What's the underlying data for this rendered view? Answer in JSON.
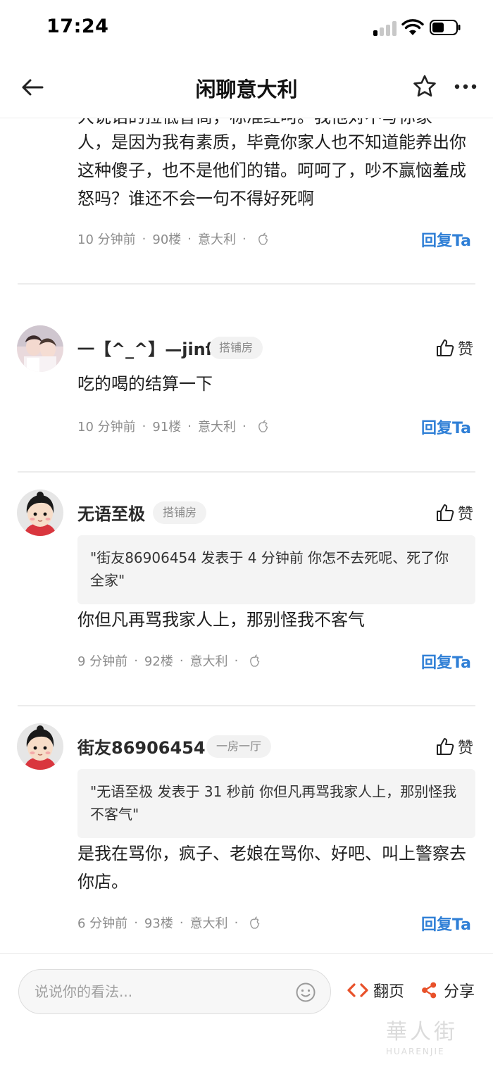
{
  "status_bar": {
    "time": "17:24"
  },
  "nav": {
    "title": "闲聊意大利"
  },
  "comments": [
    {
      "body_partial_top": "大说话的拉低智商，标准红呵。我他对不写你家",
      "body": "人，是因为我有素质，毕竟你家人也不知道能养出你这种傻子，也不是他们的错。呵呵了，吵不赢恼羞成怒吗？谁还不会一句不得好死啊",
      "time": "10 分钟前",
      "floor": "90楼",
      "location": "意大利",
      "reply_label": "回复Ta"
    },
    {
      "author": "一【^_^】—jinf",
      "badge": "搭铺房",
      "like_label": "赞",
      "body": "吃的喝的结算一下",
      "time": "10 分钟前",
      "floor": "91楼",
      "location": "意大利",
      "reply_label": "回复Ta"
    },
    {
      "author": "无语至极",
      "badge": "搭铺房",
      "like_label": "赞",
      "quote": "\"街友86906454 发表于 4 分钟前 你怎不去死呢、死了你全家\"",
      "body": "你但凡再骂我家人上，那别怪我不客气",
      "time": "9 分钟前",
      "floor": "92楼",
      "location": "意大利",
      "reply_label": "回复Ta"
    },
    {
      "author": "街友86906454",
      "badge": "一房一厅",
      "like_label": "赞",
      "quote": "\"无语至极 发表于 31 秒前 你但凡再骂我家人上，那别怪我不客气\"",
      "body": "是我在骂你，疯子、老娘在骂你、好吧、叫上警察去你店。",
      "time": "6 分钟前",
      "floor": "93楼",
      "location": "意大利",
      "reply_label": "回复Ta"
    }
  ],
  "bottom_bar": {
    "input_placeholder": "说说你的看法...",
    "page_label": "翻页",
    "share_label": "分享"
  },
  "watermark": {
    "cn": "華人街",
    "en": "HUARENJIE"
  },
  "colors": {
    "accent": "#2f7fd6",
    "orange": "#e8512a",
    "meta": "#8c8c8c"
  }
}
